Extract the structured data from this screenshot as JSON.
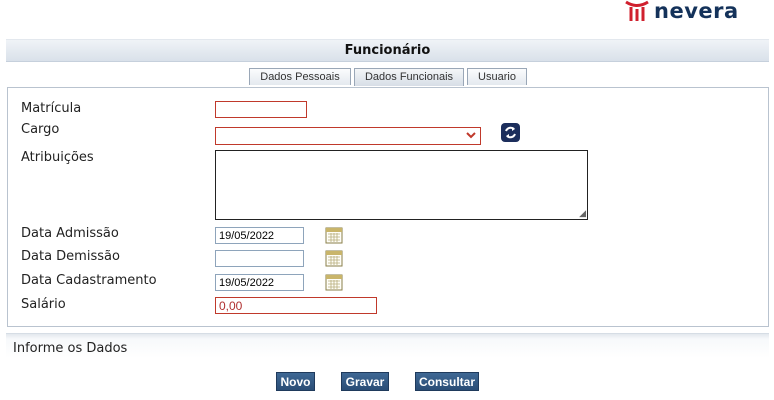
{
  "brand": {
    "name": "nevera"
  },
  "page": {
    "title": "Funcionário"
  },
  "tabs": [
    {
      "label": "Dados Pessoais",
      "active": false
    },
    {
      "label": "Dados Funcionais",
      "active": true
    },
    {
      "label": "Usuario",
      "active": false
    }
  ],
  "form": {
    "matricula": {
      "label": "Matrícula",
      "value": ""
    },
    "cargo": {
      "label": "Cargo",
      "selected": ""
    },
    "atribuicoes": {
      "label": "Atribuições",
      "value": ""
    },
    "data_admissao": {
      "label": "Data Admissão",
      "value": "19/05/2022"
    },
    "data_demissao": {
      "label": "Data Demissão",
      "value": ""
    },
    "data_cadastramento": {
      "label": "Data Cadastramento",
      "value": "19/05/2022"
    },
    "salario": {
      "label": "Salário",
      "value": "0,00"
    }
  },
  "status": {
    "message": "Informe os Dados"
  },
  "actions": {
    "novo": "Novo",
    "gravar": "Gravar",
    "consultar": "Consultar"
  },
  "colors": {
    "accent": "#2a4d76",
    "required_border": "#c0392b",
    "brand_red": "#d0202e",
    "brand_navy": "#14325a"
  },
  "icons": {
    "refresh": "refresh-icon",
    "calendar": "calendar-icon",
    "dropdown": "chevron-down-icon"
  }
}
